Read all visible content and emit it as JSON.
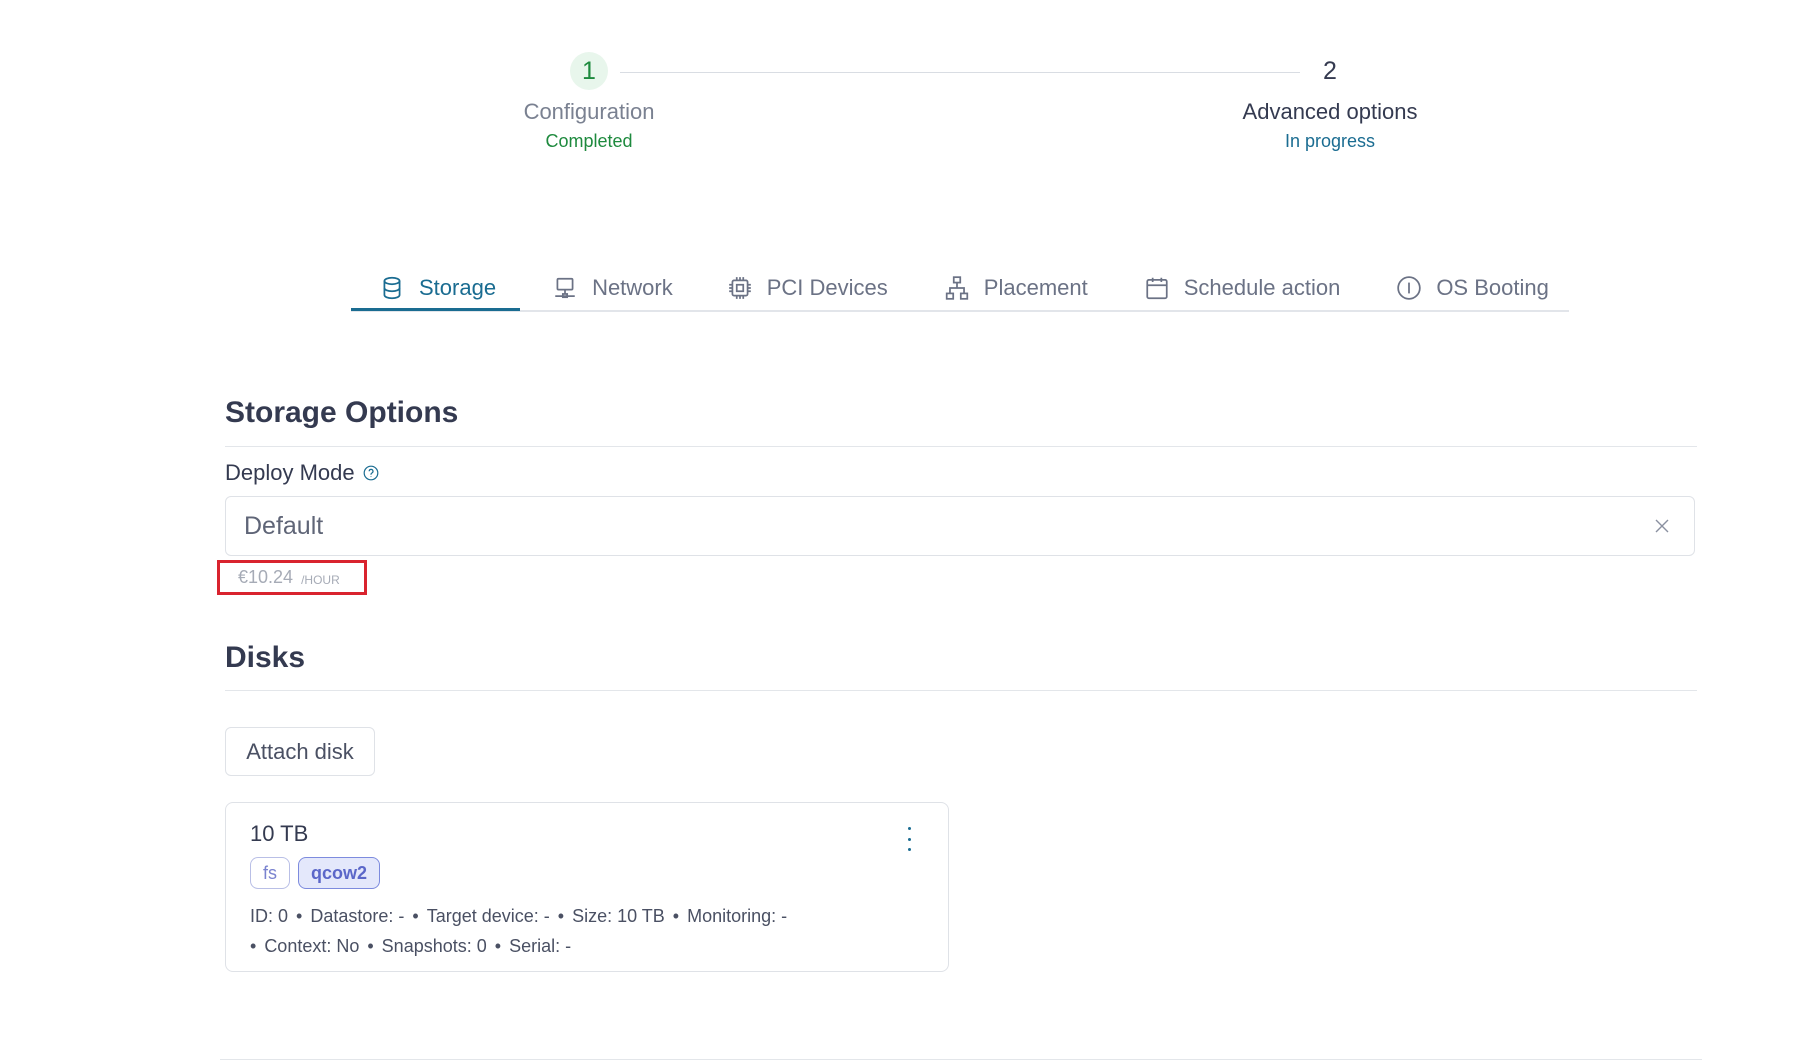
{
  "stepper": {
    "steps": [
      {
        "number": "1",
        "label": "Configuration",
        "status": "Completed"
      },
      {
        "number": "2",
        "label": "Advanced options",
        "status": "In progress"
      }
    ]
  },
  "tabs": [
    {
      "label": "Storage",
      "icon": "database-icon",
      "active": true
    },
    {
      "label": "Network",
      "icon": "monitor-network-icon"
    },
    {
      "label": "PCI Devices",
      "icon": "chip-icon"
    },
    {
      "label": "Placement",
      "icon": "hierarchy-icon"
    },
    {
      "label": "Schedule action",
      "icon": "calendar-icon"
    },
    {
      "label": "OS Booting",
      "icon": "info-circle-icon"
    }
  ],
  "storage_options": {
    "title": "Storage Options",
    "deploy_mode_label": "Deploy Mode",
    "deploy_mode_value": "Default",
    "price": "€10.24",
    "price_unit": "/HOUR"
  },
  "disks": {
    "title": "Disks",
    "attach_label": "Attach disk",
    "items": [
      {
        "size": "10 TB",
        "tags": [
          "fs",
          "qcow2"
        ],
        "meta_line1": [
          "ID: 0",
          "Datastore: -",
          "Target device: -",
          "Size: 10 TB",
          "Monitoring: -"
        ],
        "meta_line2": [
          "Context: No",
          "Snapshots: 0",
          "Serial: -"
        ]
      }
    ]
  },
  "colors": {
    "accent": "#1a6c91",
    "completed": "#1e8a3e",
    "highlight_border": "#d9232e"
  }
}
